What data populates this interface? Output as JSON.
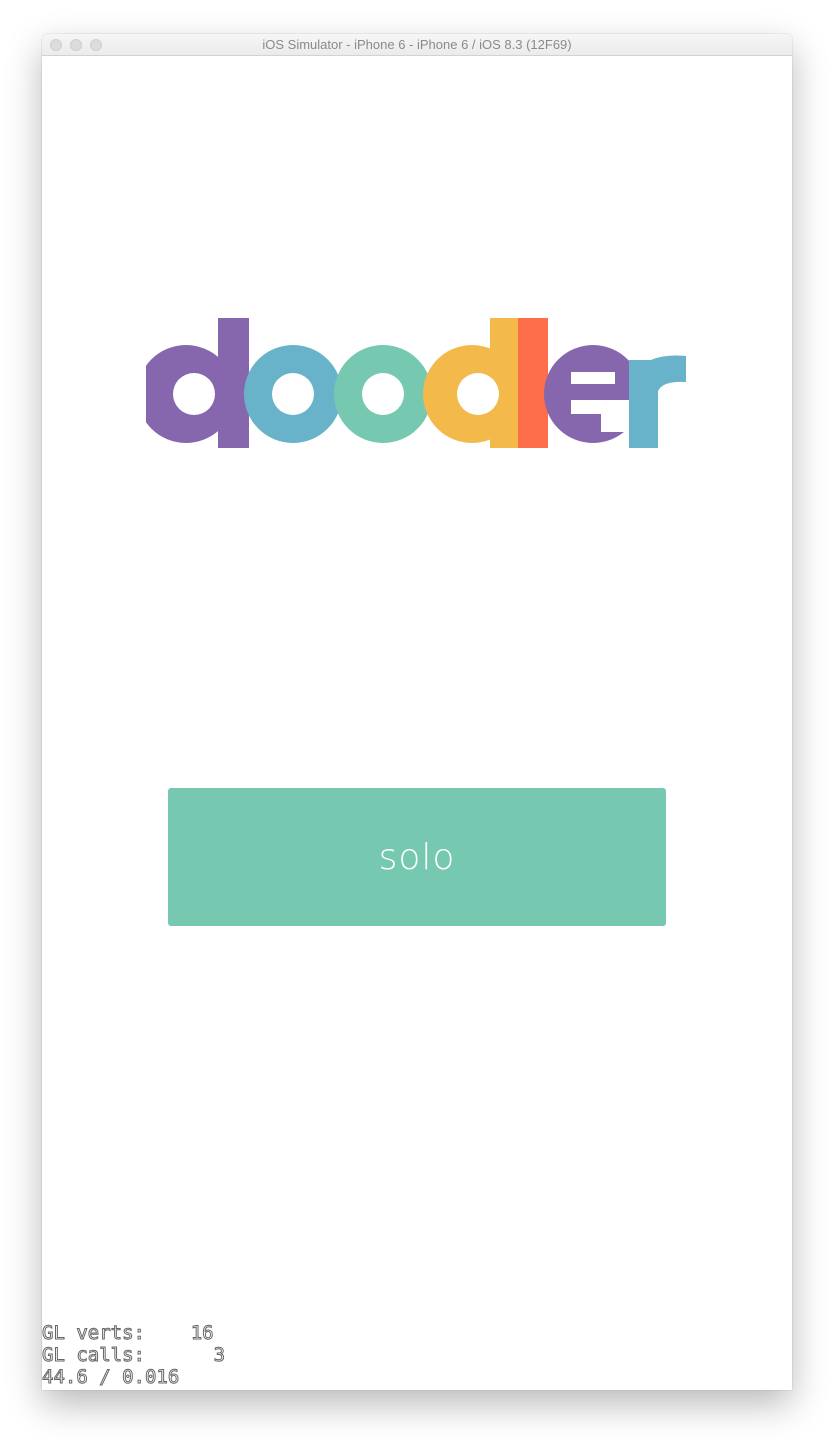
{
  "window": {
    "title": "iOS Simulator - iPhone 6 - iPhone 6 / iOS 8.3 (12F69)"
  },
  "logo": {
    "text": "doodler",
    "letters": [
      {
        "char": "d",
        "color": "#8667ad"
      },
      {
        "char": "o",
        "color": "#68b3c9"
      },
      {
        "char": "o",
        "color": "#76c9b0"
      },
      {
        "char": "d",
        "color": "#f3b94a"
      },
      {
        "char": "l",
        "color": "#ff6e4a"
      },
      {
        "char": "e",
        "color": "#8667ad"
      },
      {
        "char": "r",
        "color": "#68b3c9"
      }
    ]
  },
  "solo_button": {
    "label": "solo",
    "color": "#76c9b0"
  },
  "debug": {
    "verts_label": "GL verts:",
    "verts_value": "16",
    "calls_label": "GL calls:",
    "calls_value": "3",
    "fps_line": "44.6 / 0.016"
  }
}
